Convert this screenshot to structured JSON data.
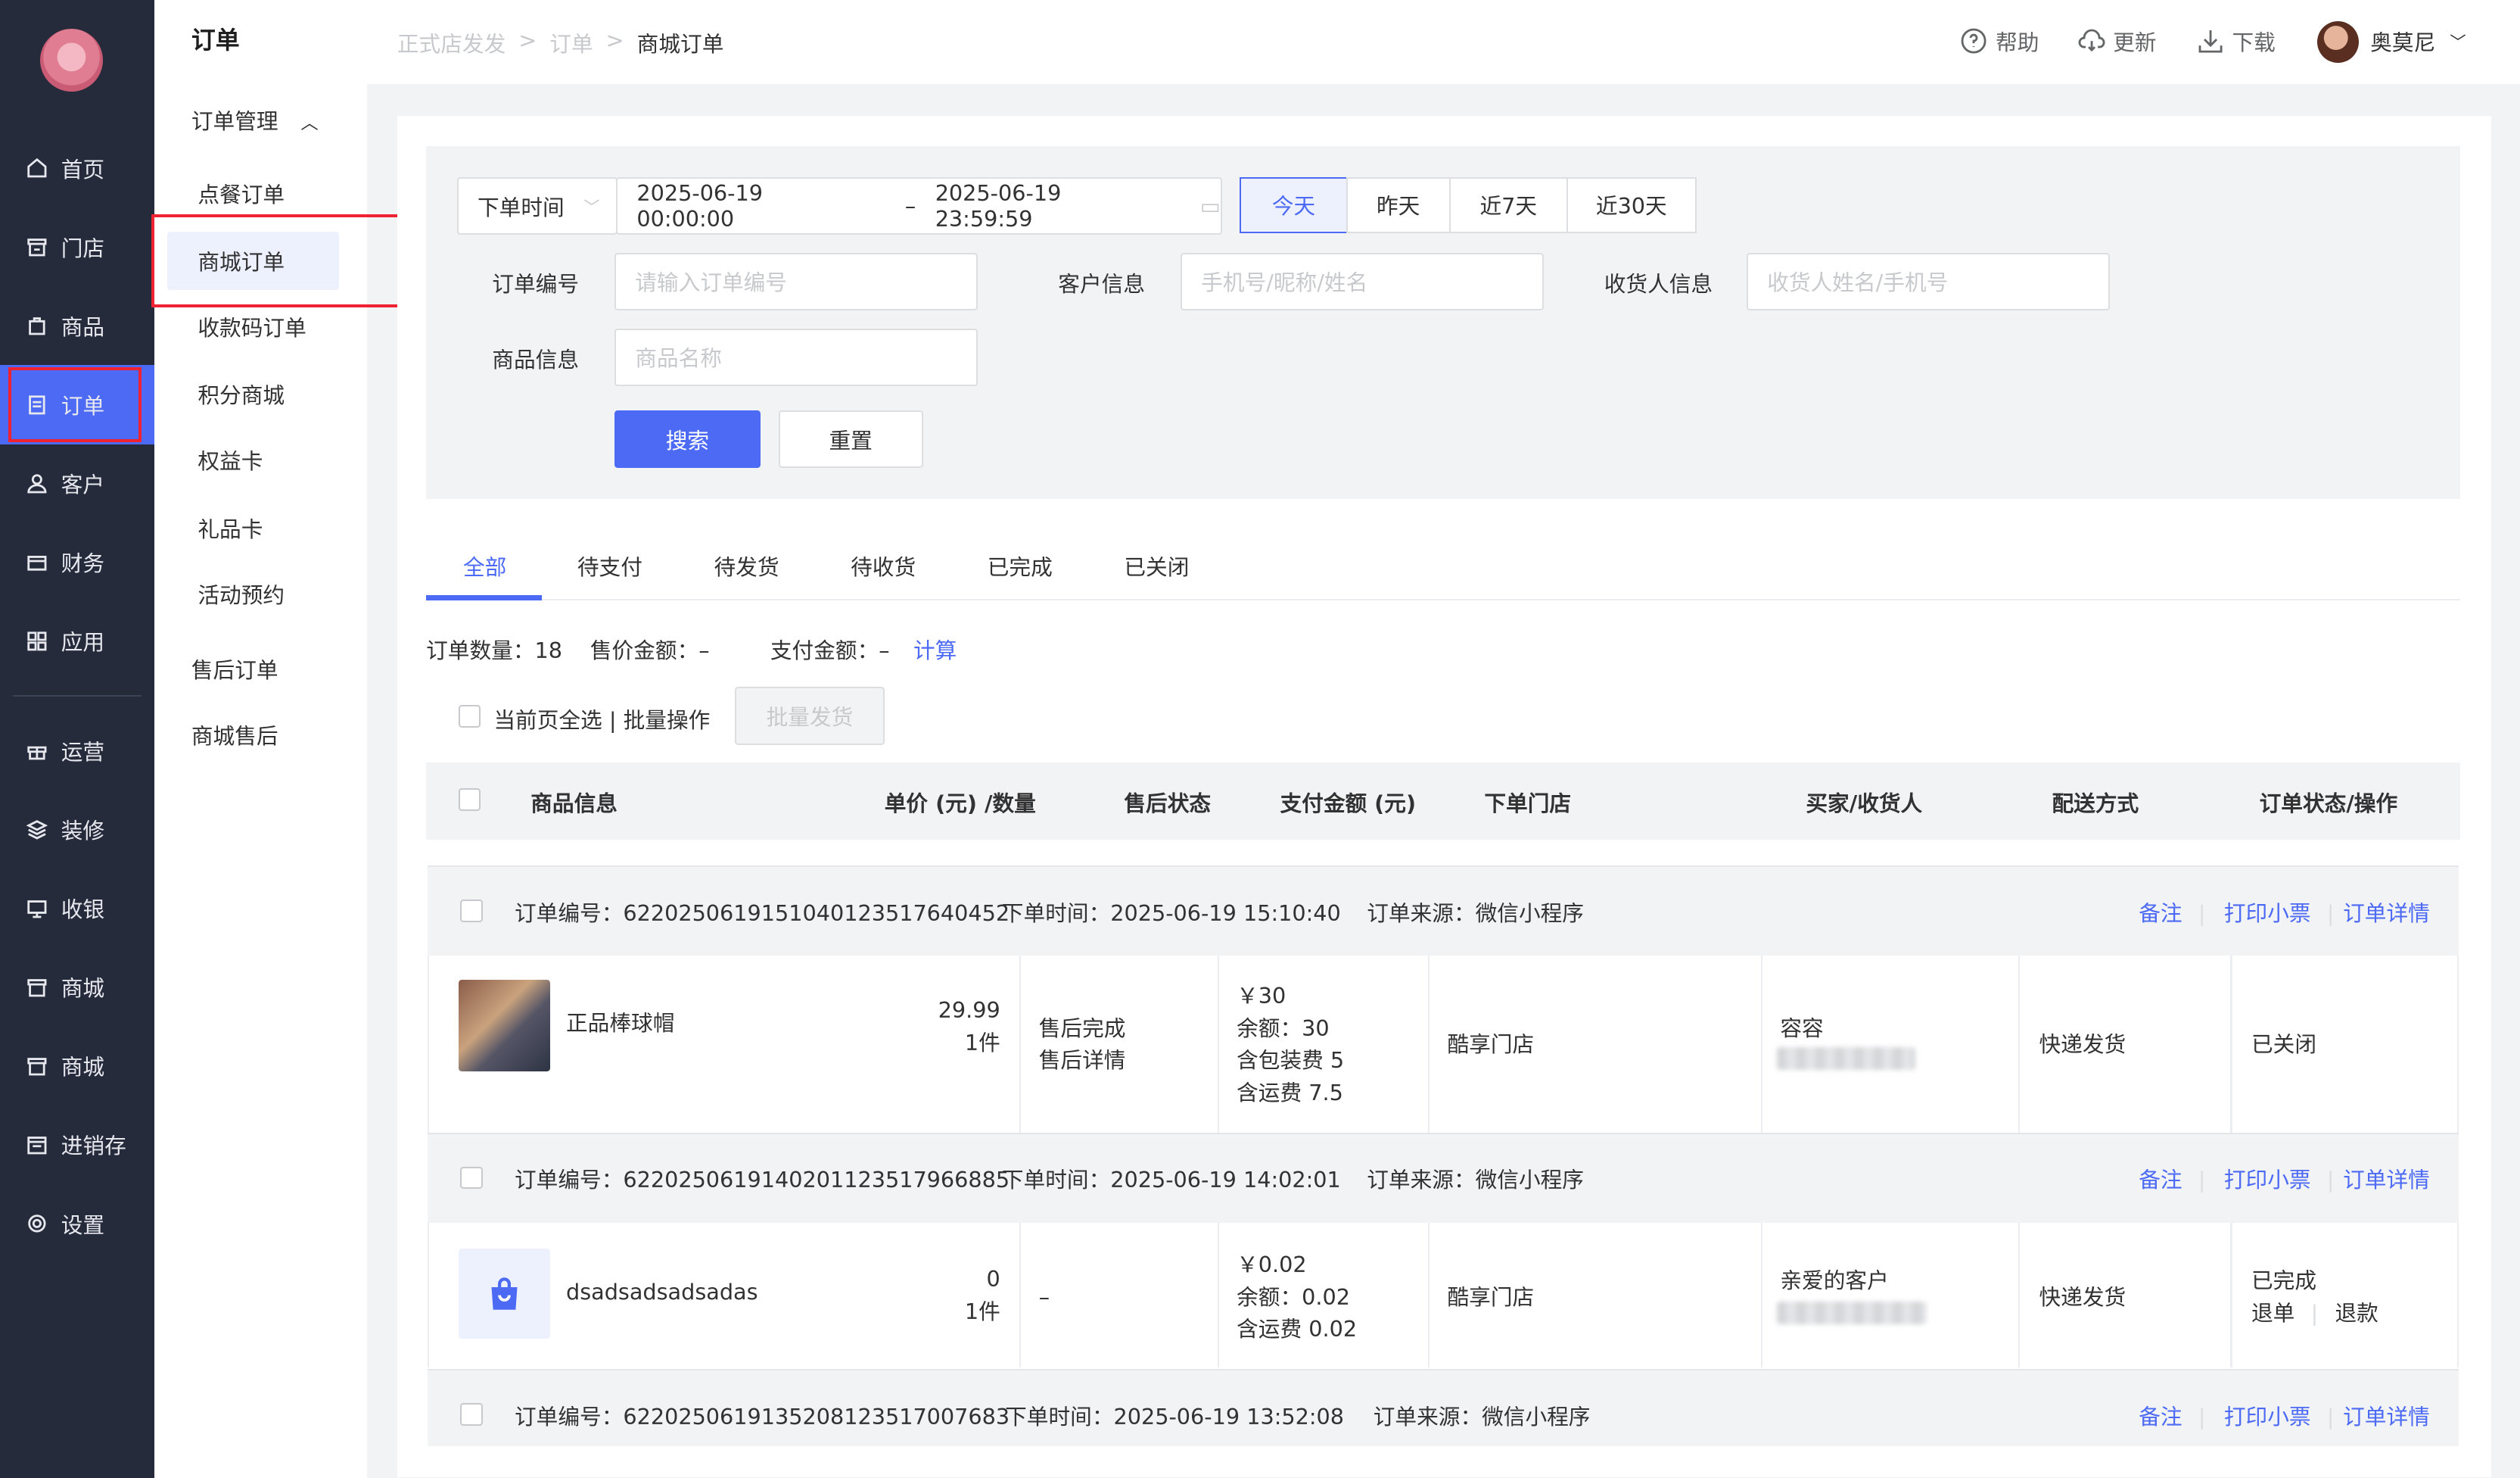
{
  "nav": {
    "items": [
      "首页",
      "门店",
      "商品",
      "订单",
      "客户",
      "财务",
      "应用",
      "运营",
      "装修",
      "收银",
      "商城",
      "商城",
      "进销存",
      "设置"
    ]
  },
  "submenu": {
    "title": "订单",
    "group": "订单管理",
    "items": [
      "点餐订单",
      "商城订单",
      "收款码订单",
      "积分商城",
      "权益卡",
      "礼品卡",
      "活动预约"
    ],
    "extra": [
      "售后订单",
      "商城售后"
    ]
  },
  "breadcrumb": {
    "a": "正式店发发",
    "b": "订单",
    "c": "商城订单"
  },
  "toolbar": {
    "help": "帮助",
    "update": "更新",
    "download": "下载",
    "user": "奥莫尼"
  },
  "filter": {
    "time_type": "下单时间",
    "start": "2025-06-19 00:00:00",
    "dash": "–",
    "end": "2025-06-19 23:59:59",
    "quick": [
      "今天",
      "昨天",
      "近7天",
      "近30天"
    ],
    "order_no_label": "订单编号",
    "order_no_ph": "请输入订单编号",
    "customer_label": "客户信息",
    "customer_ph": "手机号/昵称/姓名",
    "receiver_label": "收货人信息",
    "receiver_ph": "收货人姓名/手机号",
    "goods_label": "商品信息",
    "goods_ph": "商品名称",
    "search": "搜索",
    "reset": "重置"
  },
  "tabs": [
    "全部",
    "待支付",
    "待发货",
    "待收货",
    "已完成",
    "已关闭"
  ],
  "stats": {
    "count": "订单数量：18",
    "sale": "售价金额：–",
    "pay": "支付金额：–",
    "calc": "计算"
  },
  "batch": {
    "select_all": "当前页全选 | 批量操作",
    "ship": "批量发货"
  },
  "columns": [
    "商品信息",
    "单价 (元) /数量",
    "售后状态",
    "支付金额 (元)",
    "下单门店",
    "买家/收货人",
    "配送方式",
    "订单状态/操作"
  ],
  "order_actions": {
    "note": "备注",
    "print": "打印小票",
    "detail": "订单详情"
  },
  "orders": [
    {
      "no": "订单编号：6220250619151040123517640452",
      "time": "下单时间：2025-06-19 15:10:40",
      "source": "订单来源：微信小程序",
      "goods": "正品棒球帽",
      "price": "29.99",
      "qty": "1件",
      "after": "售后完成",
      "after_link": "售后详情",
      "pay": [
        "￥30",
        "余额：30",
        "含包装费 5",
        "含运费 7.5"
      ],
      "store": "酷享门店",
      "buyer": "容容",
      "ship": "快递发货",
      "status": "已关闭"
    },
    {
      "no": "订单编号：6220250619140201123517966885",
      "time": "下单时间：2025-06-19 14:02:01",
      "source": "订单来源：微信小程序",
      "goods": "dsadsadsadsadas",
      "price": "0",
      "qty": "1件",
      "after": "–",
      "pay": [
        "￥0.02",
        "余额：0.02",
        "含运费 0.02"
      ],
      "store": "酷享门店",
      "buyer": "亲爱的客户",
      "ship": "快递发货",
      "status": "已完成",
      "act1": "退单",
      "act2": "退款"
    },
    {
      "no": "订单编号：6220250619135208123517007683",
      "time": "下单时间：2025-06-19 13:52:08",
      "source": "订单来源：微信小程序"
    }
  ],
  "colors": {
    "accent": "#4c6af4",
    "sidebar": "#262b3c",
    "highlight": "#e02a2a"
  }
}
